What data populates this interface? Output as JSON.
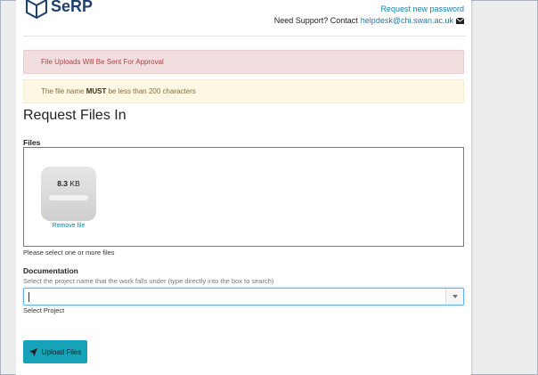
{
  "header": {
    "logo_text": "SeRP",
    "request_password_link": "Request new password",
    "support_text": "Need Support? Contact",
    "support_email": "helpdesk@chi.swan.ac.uk",
    "mail_icon": "envelope-icon"
  },
  "alerts": {
    "approval": "File Uploads Will Be Sent For Approval",
    "filename_prefix": "The file name",
    "filename_emphasis": "MUST",
    "filename_suffix": "be less than 200 characters"
  },
  "page": {
    "title": "Request Files In"
  },
  "files": {
    "label": "Files",
    "file": {
      "size_value": "8.3",
      "size_unit": "KB",
      "remove_label": "Remove file"
    },
    "help": "Please select one or more files"
  },
  "documentation": {
    "label": "Documentation",
    "hint": "Select the project name that the work falls under (type directly into the box to search)",
    "input_value": "",
    "caption": "Select Project"
  },
  "actions": {
    "upload_label": "Upload Files",
    "upload_icon": "paper-plane-icon"
  },
  "colors": {
    "brand": "#1f3f6e",
    "link": "#1a7fa8",
    "danger_bg": "#f2dede",
    "warning_bg": "#fcf8e3",
    "button": "#17a2b8"
  }
}
